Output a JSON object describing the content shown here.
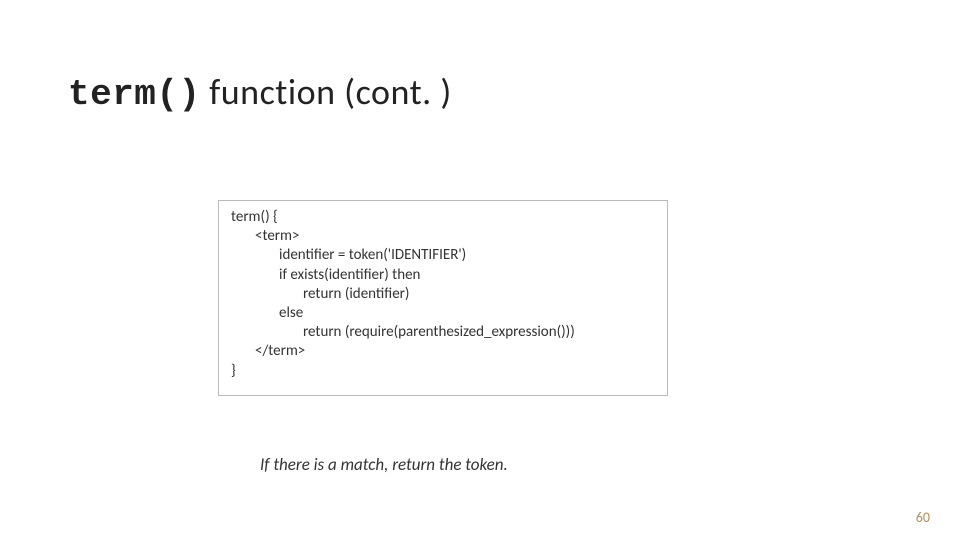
{
  "title": {
    "mono": "term()",
    "rest": " function (cont. )"
  },
  "code": {
    "l0a": "term() {",
    "l1a": "<term>",
    "l2a": "identifier = token('IDENTIFIER')",
    "l2b": "if exists(identifier) then",
    "l3a": "return (identifier)",
    "l2c": "else",
    "l3b": "return (require(parenthesized_expression()))",
    "l1b": "</term>",
    "l0b": "}"
  },
  "caption": "If there is a match, return the token.",
  "pagenum": "60"
}
